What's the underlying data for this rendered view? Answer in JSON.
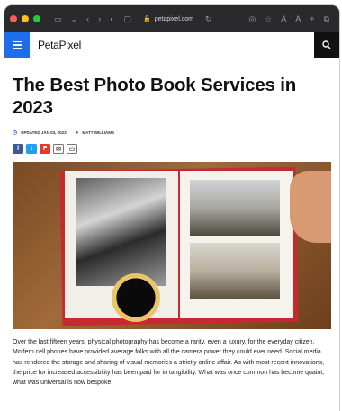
{
  "browser": {
    "url": "petapixel.com",
    "lock_icon": "lock-icon"
  },
  "site": {
    "logo": "PetaPixel"
  },
  "article": {
    "title": "The Best Photo Book Services in 2023",
    "updated": "UPDATED JAN 03, 2023",
    "author": "MATT WILLIAMS",
    "share_icons": [
      "facebook-icon",
      "twitter-icon",
      "flipboard-icon",
      "email-icon",
      "comment-icon"
    ],
    "body": "Over the last fifteen years, physical photography has become a rarity, even a luxury, for the everyday citizen. Modern cell phones have provided average folks with all the camera power they could ever need. Social media has rendered the storage and sharing of visual memories a strictly online affair. As with most recent innovations, the price for increased accessibility has been paid for in tangibility. What was once common has become quaint, what was universal is now bespoke."
  },
  "colors": {
    "accent": "#1d6ee8",
    "toolbar": "#2a2a2c"
  }
}
